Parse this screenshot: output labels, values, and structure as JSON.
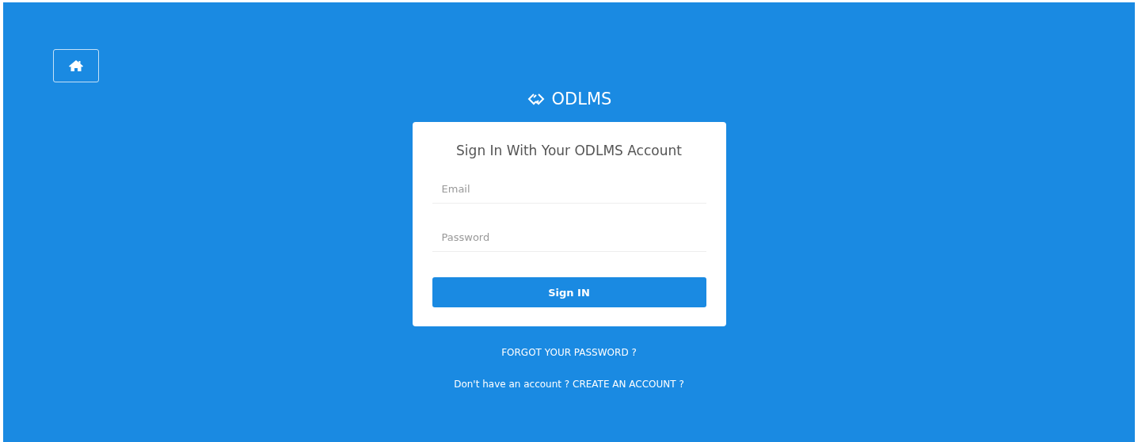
{
  "brand": {
    "name": "ODLMS"
  },
  "card": {
    "title": "Sign In With Your ODLMS Account",
    "fields": [
      {
        "placeholder": "Email"
      },
      {
        "placeholder": "Password"
      }
    ],
    "submit": "Sign IN"
  },
  "forgot_link": "FORGOT YOUR PASSWORD ?",
  "signup": {
    "text": "Don't have an account ?",
    "link": "CREATE AN ACCOUNT ?"
  }
}
